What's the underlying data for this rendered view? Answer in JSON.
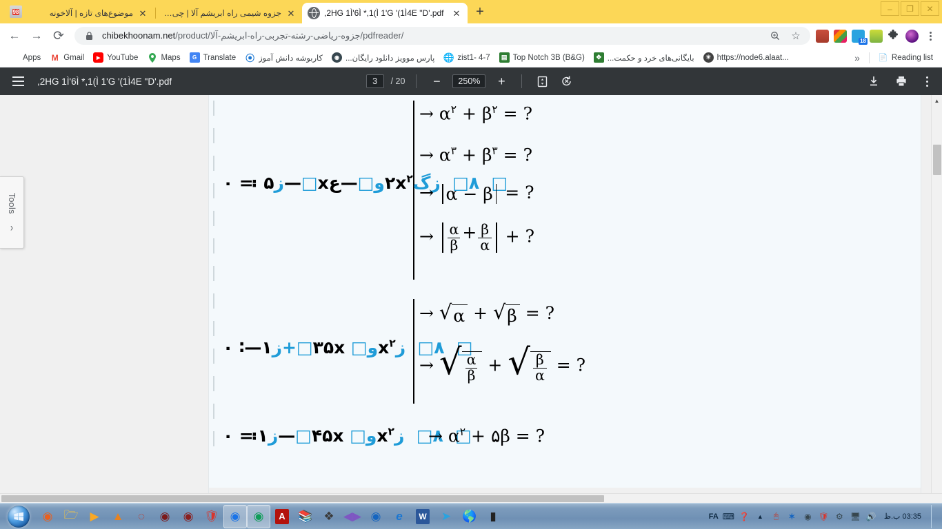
{
  "window": {
    "minimize_label": "–",
    "maximize_label": "❐",
    "close_label": "✕"
  },
  "tabs": [
    {
      "id": "tab-1",
      "label": "موضوع‌های تازه | آلاخونه",
      "close_label": "✕",
      "active": false,
      "favicon": "site98-icon"
    },
    {
      "id": "tab-2",
      "label": "جزوه شیمی راه ابریشم آلا | چی بخونم",
      "close_label": "✕",
      "active": false,
      "favicon": "leaf-icon"
    },
    {
      "id": "tab-3",
      "label": ",2HG 1Ì'6Ì *,1(Ì 1'G '(1Ì4E \"D'.pdf",
      "close_label": "✕",
      "active": true,
      "favicon": "globe-icon"
    }
  ],
  "newtab_label": "+",
  "omnibox": {
    "back_label": "←",
    "forward_label": "→",
    "reload_label": "⟳",
    "lock_icon": "lock-icon",
    "url_prefix": "chibekhoonam.net",
    "url_mid": "/product/",
    "url_fa": "جزوه-ریاضی-رشته-تجربی-راه-ابریشم-آلا",
    "url_suffix": "/pdfreader/",
    "zoom_icon": "zoom-in-icon",
    "star_icon": "bookmark-star-icon",
    "star_label": "☆",
    "menu_icon": "three-dot-menu-icon"
  },
  "extensions": [
    {
      "name": "dictionary-extension-icon",
      "color": "#c94f3d",
      "badge": ""
    },
    {
      "name": "colorpalette-extension-icon",
      "color": "#f7b500",
      "badge": ""
    },
    {
      "name": "download-manager-extension-icon",
      "color": "#29a3e0",
      "badge": "18"
    },
    {
      "name": "green-extension-icon",
      "color": "#8bc34a",
      "badge": ""
    },
    {
      "name": "puzzle-extensions-icon",
      "color": "#3c4043",
      "badge": ""
    },
    {
      "name": "user-avatar-icon",
      "color": "#6a1b9a",
      "badge": ""
    }
  ],
  "bookmarks": {
    "items": [
      {
        "label": "Apps",
        "icon": "apps-grid-icon",
        "color": "#4285f4",
        "rtl": false
      },
      {
        "label": "Gmail",
        "icon": "gmail-icon",
        "color": "#ea4335",
        "rtl": false
      },
      {
        "label": "YouTube",
        "icon": "youtube-icon",
        "color": "#ff0000",
        "rtl": false
      },
      {
        "label": "Maps",
        "icon": "maps-pin-icon",
        "color": "#34a853",
        "rtl": false
      },
      {
        "label": "Translate",
        "icon": "translate-icon",
        "color": "#4285f4",
        "rtl": false
      },
      {
        "label": "کاربوشه دانش آموز",
        "icon": "blue-drop-icon",
        "color": "#1976d2",
        "rtl": true
      },
      {
        "label": "پارس موویز دانلود رایگان...",
        "icon": "film-reel-icon",
        "color": "#37474f",
        "rtl": true
      },
      {
        "label": "zist1- 4-7",
        "icon": "globe-blue-icon",
        "color": "#1565c0",
        "rtl": false
      },
      {
        "label": "Top Notch 3B (B&G)",
        "icon": "green-book-icon",
        "color": "#2e7d32",
        "rtl": false
      },
      {
        "label": "بایگانی‌های خرد و حکمت...",
        "icon": "feather-icon",
        "color": "#2e7d32",
        "rtl": true
      },
      {
        "label": "https://node6.alaat...",
        "icon": "globe-dark-icon",
        "color": "#424242",
        "rtl": false
      }
    ],
    "overflow_label": "»",
    "reading_list_label": "Reading list",
    "reading_list_icon": "reading-list-icon"
  },
  "pdf_toolbar": {
    "menu_icon": "hamburger-menu-icon",
    "filename": ",2HG 1Ì'6Ì *,1(Ì 1'G '(1Ì4E \"D'.pdf",
    "current_page": "3",
    "total_pages": "/ 20",
    "zoom_out_label": "−",
    "zoom_value": "250%",
    "zoom_in_label": "+",
    "fit_icon": "fit-page-icon",
    "rotate_icon": "rotate-ccw-icon",
    "download_icon": "download-icon",
    "print_icon": "print-icon",
    "more_icon": "more-vertical-icon"
  },
  "viewer": {
    "tools_label": "Tools",
    "tools_chevron": "›",
    "scroll_up_label": "▲"
  },
  "document": {
    "blocks": [
      {
        "id": "block-1",
        "equation_rtl": "اگر ۲x² − اx − ۵ = ۰",
        "questions": [
          "→ α² + β² = ?",
          "→ α³ + β³ = ?",
          "→ |α − β| = ?",
          "→ |α/β + β/α| + ?"
        ]
      },
      {
        "id": "block-2",
        "equation_rtl": "اگر x² و ۳۵x + ۱ = ۰",
        "questions": [
          "→ √α + √β = ?",
          "→ √(α/β) + √(β/α) = ?"
        ]
      },
      {
        "id": "block-3",
        "equation_rtl": "اگر x² و ۴۵x − ۱ = ۰",
        "questions": [
          "→ α² + ۵β = ?"
        ]
      }
    ]
  },
  "taskbar": {
    "start_label": "",
    "items": [
      {
        "name": "firefox-taskbar-icon",
        "glyph": "🦊",
        "running": false
      },
      {
        "name": "file-explorer-taskbar-icon",
        "glyph": "🗂",
        "running": false
      },
      {
        "name": "media-player-taskbar-icon",
        "glyph": "▶",
        "running": false
      },
      {
        "name": "vlc-taskbar-icon",
        "glyph": "🚧",
        "running": false
      },
      {
        "name": "opera-taskbar-icon",
        "glyph": "◎",
        "running": false
      },
      {
        "name": "idm-taskbar-icon",
        "glyph": "◉",
        "running": false
      },
      {
        "name": "record-taskbar-icon",
        "glyph": "◉",
        "running": false
      },
      {
        "name": "shield-taskbar-icon",
        "glyph": "🛡",
        "running": false
      },
      {
        "name": "chrome-taskbar-icon",
        "glyph": "●",
        "running": true
      },
      {
        "name": "chrome-canary-taskbar-icon",
        "glyph": "●",
        "running": true
      },
      {
        "name": "acrobat-taskbar-icon",
        "glyph": "A",
        "running": false
      },
      {
        "name": "books-taskbar-icon",
        "glyph": "📚",
        "running": false
      },
      {
        "name": "app-taskbar-icon",
        "glyph": "❖",
        "running": false
      },
      {
        "name": "potplayer-taskbar-icon",
        "glyph": "▶",
        "running": false
      },
      {
        "name": "wmp-taskbar-icon",
        "glyph": "▶",
        "running": false
      },
      {
        "name": "internet-explorer-taskbar-icon",
        "glyph": "e",
        "running": false
      },
      {
        "name": "word-taskbar-icon",
        "glyph": "W",
        "running": false
      },
      {
        "name": "telegram-taskbar-icon",
        "glyph": "➤",
        "running": false
      },
      {
        "name": "globe-app-taskbar-icon",
        "glyph": "🌐",
        "running": false
      },
      {
        "name": "usb-taskbar-icon",
        "glyph": "▮",
        "running": false
      }
    ],
    "tray": {
      "language": "FA",
      "keyboard_icon": "keyboard-icon",
      "help_icon": "help-icon",
      "expand_icon": "show-hidden-icons-icon",
      "mouse_icon": "mouse-icon",
      "bluetooth_icon": "bluetooth-icon",
      "webcam_icon": "webcam-icon",
      "security_icon": "security-shield-icon",
      "safely_remove_icon": "safely-remove-hardware-icon",
      "network_icon": "network-icon",
      "volume_icon": "volume-icon",
      "time": "03:35",
      "date": "ب.ظ"
    }
  }
}
